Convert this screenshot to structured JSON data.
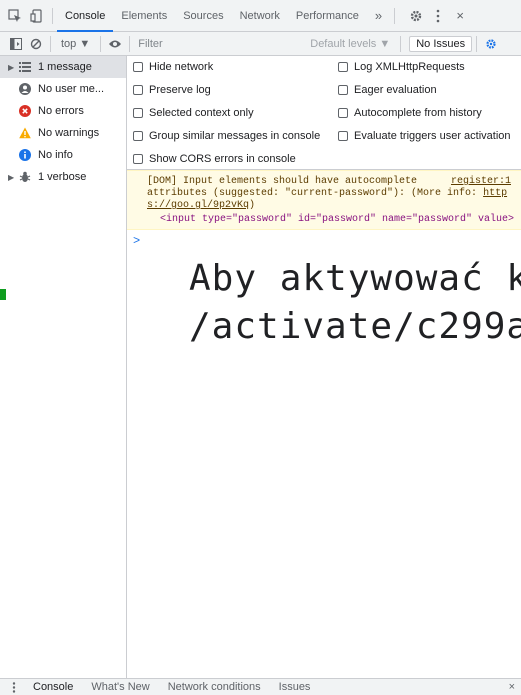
{
  "tabs": {
    "console": "Console",
    "elements": "Elements",
    "sources": "Sources",
    "network": "Network",
    "performance": "Performance",
    "more": "»"
  },
  "toolbar": {
    "context": "top ▼",
    "filter_placeholder": "Filter",
    "levels": "Default levels ▼",
    "issues": "No Issues"
  },
  "sidebar": {
    "items": [
      {
        "label": "1 message",
        "icon": "list-icon",
        "color": "#5f6368"
      },
      {
        "label": "No user me...",
        "icon": "user-icon",
        "color": "#5f6368"
      },
      {
        "label": "No errors",
        "icon": "error-icon",
        "color": "#d93025"
      },
      {
        "label": "No warnings",
        "icon": "warning-icon",
        "color": "#f9ab00"
      },
      {
        "label": "No info",
        "icon": "info-icon",
        "color": "#1a73e8"
      },
      {
        "label": "1 verbose",
        "icon": "bug-icon",
        "color": "#5f6368"
      }
    ]
  },
  "settings": {
    "hide_network": "Hide network",
    "preserve_log": "Preserve log",
    "selected_context": "Selected context only",
    "group_similar": "Group similar messages in console",
    "show_cors": "Show CORS errors in console",
    "log_xhr": "Log XMLHttpRequests",
    "eager_eval": "Eager evaluation",
    "autocomplete": "Autocomplete from history",
    "evaluate_triggers": "Evaluate triggers user activation"
  },
  "console": {
    "warning_line1": "[DOM] Input elements should have autocomplete",
    "warning_source": "register:1",
    "warning_line2_pre": "attributes (suggested: \"current-password\"): (More info: ",
    "warning_link_a": "http",
    "warning_link_b": "s://goo.gl/9p2vKq",
    "warning_line3_post": ")",
    "warning_code": "<input type=\"password\" id=\"password\" name=\"password\" value>",
    "prompt": ">",
    "big_line1": "Aby aktywować k",
    "big_line2": "/activate/c299a"
  },
  "drawer": {
    "console": "Console",
    "whats_new": "What's New",
    "network_conditions": "Network conditions",
    "issues": "Issues",
    "close": "×"
  },
  "colors": {
    "accent": "#1a73e8",
    "marker": "#0f9d1f",
    "warning_bg": "#fffbe5"
  }
}
